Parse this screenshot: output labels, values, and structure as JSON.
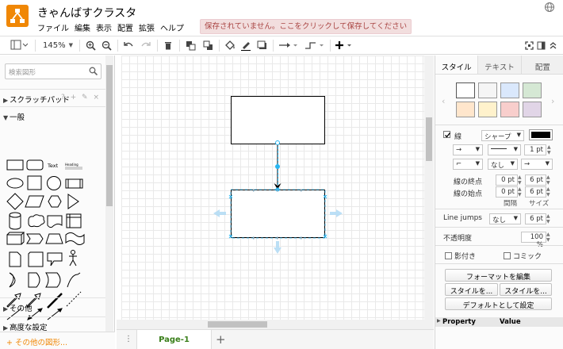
{
  "app": {
    "title": "きゃんばすクラスタ",
    "menu": [
      "ファイル",
      "編集",
      "表示",
      "配置",
      "拡張",
      "ヘルプ"
    ],
    "save_warning": "保存されていません。ここをクリックして保存してください"
  },
  "toolbar": {
    "zoom": "145%"
  },
  "sidebar": {
    "search_placeholder": "検索図形",
    "scratchpad_label": "スクラッチパッド",
    "scratchpad_tools": "? + ✎ ×",
    "general_label": "一般",
    "shape_text_label": "Text",
    "shape_heading_label": "Heading",
    "other_label": "その他",
    "advanced_label": "高度な設定",
    "more_shapes_label": "+ その他の図形..."
  },
  "pages": {
    "active_tab": "Page-1",
    "add_icon": "+"
  },
  "format_panel": {
    "tabs": [
      "スタイル",
      "テキスト",
      "配置"
    ],
    "swatch_colors": [
      "#ffffff",
      "#f5f5f5",
      "#dae8fc",
      "#d5e8d4",
      "#ffe6cc",
      "#fff2cc",
      "#f8cecc",
      "#e1d5e7"
    ],
    "line_label": "線",
    "line_style": "シャープ",
    "line_color": "#000000",
    "line_width": "1 pt",
    "waypoint_none": "なし",
    "end_label": "線の終点",
    "end_size": "0 pt",
    "end_spacing": "6 pt",
    "start_label": "線の始点",
    "start_size": "0 pt",
    "start_spacing": "6 pt",
    "spacing_label": "間隔",
    "size_label": "サイズ",
    "line_jumps_label": "Line jumps",
    "line_jumps_value": "なし",
    "line_jumps_size": "6 pt",
    "opacity_label": "不透明度",
    "opacity_value": "100 %",
    "shadow_label": "影付き",
    "comic_label": "コミック",
    "edit_style_button": "フォーマットを編集",
    "copy_style_button": "スタイルを...",
    "paste_style_button": "スタイルを...",
    "set_default_button": "デフォルトとして設定",
    "property_header": "Property",
    "value_header": "Value"
  },
  "colors": {
    "accent": "#f08705",
    "selection": "#29b6f2",
    "page_tab_text": "#3a7f1a",
    "warning_bg": "#f2dede",
    "warning_text": "#a94442"
  }
}
